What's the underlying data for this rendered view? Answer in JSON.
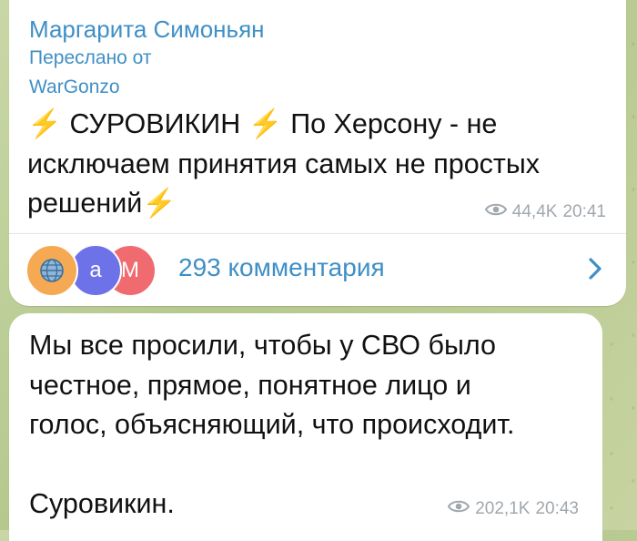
{
  "message1": {
    "sender": "Маргарита Симоньян",
    "forwarded_label": "Переслано от",
    "forwarded_from": "WarGonzo",
    "lines": [
      {
        "pre_bolt": true,
        "text": " СУРОВИКИН ",
        "mid_bolt": true,
        "text2": " По Херсону - не"
      },
      {
        "text": "исключаем принятия самых не простых"
      },
      {
        "text": "решений",
        "post_bolt": true
      }
    ],
    "line1_a": "СУРОВИКИН",
    "line1_b": "По Херсону - не",
    "line2": "исключаем принятия самых не простых",
    "line3": "решений",
    "views": "44,4K",
    "time": "20:41",
    "comments": "293 комментария",
    "avatar_letters": [
      "а",
      "М"
    ]
  },
  "message2": {
    "line1": "Мы все просили, чтобы у СВО было",
    "line2": "честное, прямое, понятное лицо и",
    "line3": "голос, объясняющий, что происходит.",
    "line4": "Суровикин.",
    "views": "202,1K",
    "time": "20:43"
  },
  "colors": {
    "accent": "#3f8fc6",
    "meta": "#a0a7ad",
    "bolt": "#f0b323"
  }
}
